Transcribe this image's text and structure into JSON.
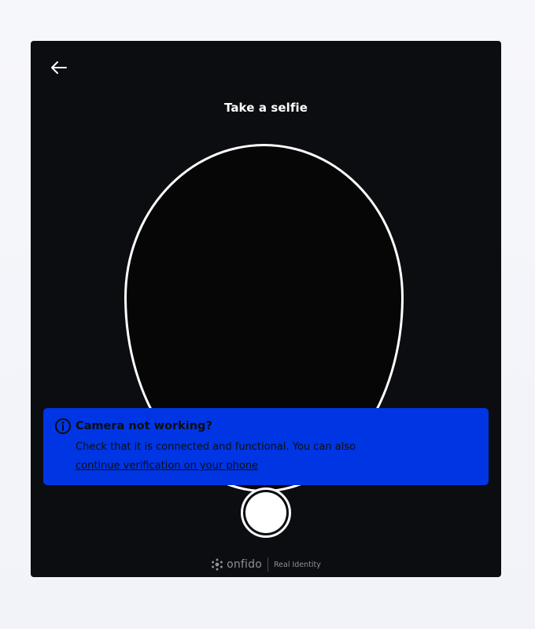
{
  "screen": {
    "title": "Take a selfie"
  },
  "navigation": {
    "back_icon": "arrow-left-icon"
  },
  "alert": {
    "icon": "info-circle-icon",
    "title": "Camera not working?",
    "message": "Check that it is connected and functional. You can also",
    "link_text": "continue verification on your phone",
    "background_color": "#0035e4"
  },
  "capture": {
    "shutter_icon": "shutter-button"
  },
  "footer": {
    "brand": "onfido",
    "tagline": "Real Identity",
    "logo_icon": "onfido-logo-icon"
  }
}
